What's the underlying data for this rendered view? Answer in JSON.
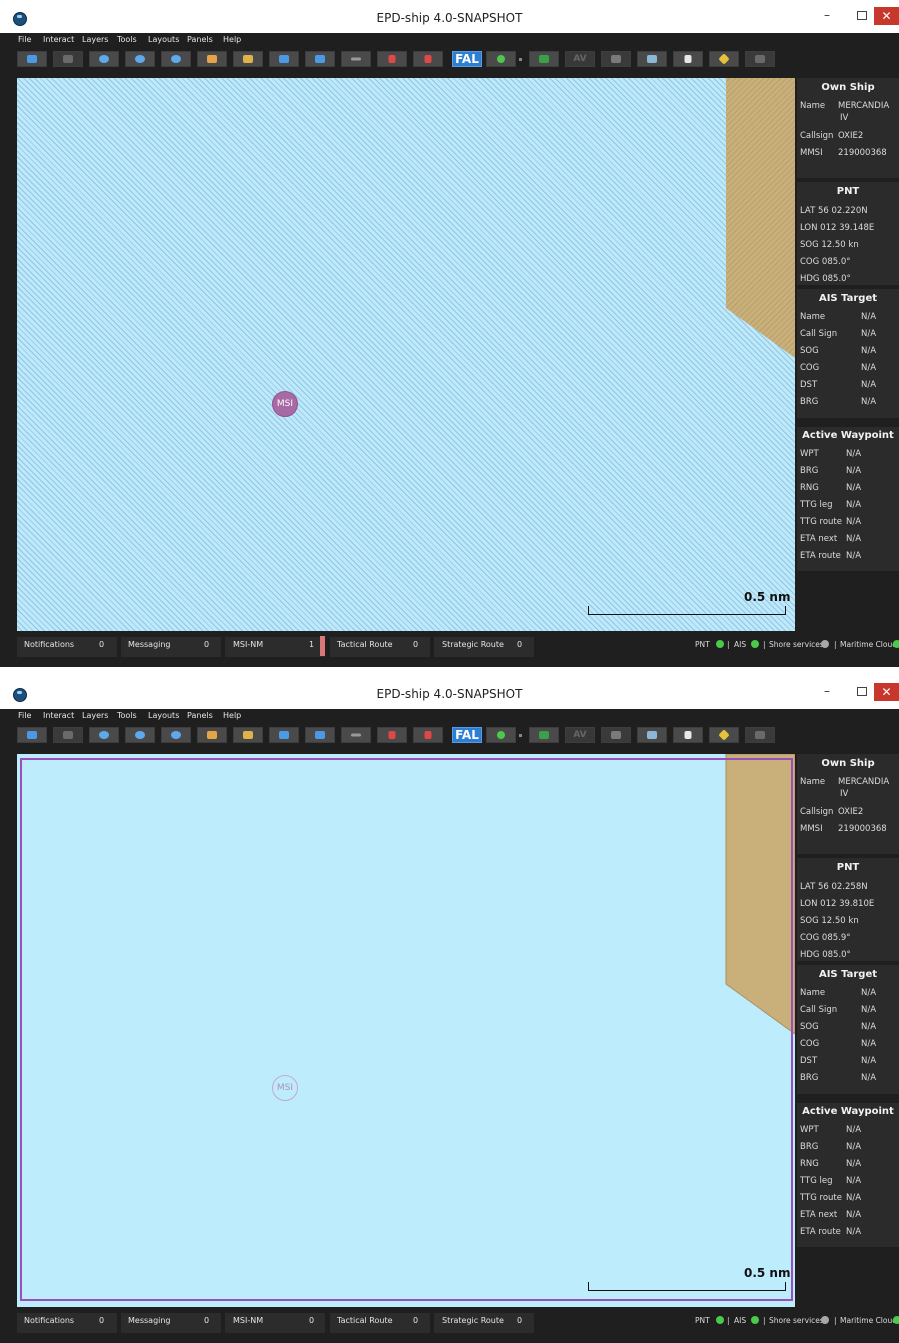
{
  "app": {
    "title": "EPD-ship 4.0-SNAPSHOT"
  },
  "window_controls": {
    "minimize": "–",
    "close": "✕"
  },
  "menu": [
    "File",
    "Interact",
    "Layers",
    "Tools",
    "Layouts",
    "Panels",
    "Help"
  ],
  "toolbar": {
    "fal_label": "FAL",
    "av_label": "AV"
  },
  "icons": [
    "back-arrow-icon",
    "forward-arrow-icon",
    "zoom-in-icon",
    "zoom-out-icon",
    "zoom-fit-icon",
    "pan-hand-icon",
    "ruler-icon",
    "center-target-icon",
    "route-arrow-icon",
    "wrench-icon",
    "new-waypoint-icon",
    "route-pin-icon",
    "fal-icon",
    "ais-status-icon",
    "nogo-icon",
    "av-icon",
    "layer-icon",
    "map-icon",
    "document-icon",
    "warning-sign-icon",
    "settings-icon"
  ],
  "colors": {
    "sea": "#bfe9fa",
    "land": "#c9b07a",
    "toolbar_bg": "#1f1f1f",
    "panel_bg": "#2b2b2b",
    "fal_blue": "#2d7fd4",
    "msi_purple": "#a86aa5",
    "boundary_purple": "#9a4fbf",
    "led_green": "#4ac94a"
  },
  "map": {
    "msi_label": "MSI",
    "scale_label": "0.5 nm"
  },
  "own_ship": {
    "title": "Own Ship",
    "name_label": "Name",
    "name_value_1": "MERCANDIA",
    "name_value_2": "IV",
    "callsign_label": "Callsign",
    "callsign_value": "OXIE2",
    "mmsi_label": "MMSI",
    "mmsi_value": "219000368"
  },
  "pnt_w1": {
    "title": "PNT",
    "lat": "LAT  56 02.220N",
    "lon": "LON  012 39.148E",
    "sog": "SOG  12.50 kn",
    "cog": "COG  085.0°",
    "hdg": "HDG  085.0°"
  },
  "pnt_w2": {
    "title": "PNT",
    "lat": "LAT  56 02.258N",
    "lon": "LON  012 39.810E",
    "sog": "SOG  12.50 kn",
    "cog": "COG  085.9°",
    "hdg": "HDG  085.0°"
  },
  "ais_target": {
    "title": "AIS Target",
    "rows": [
      {
        "label": "Name",
        "value": "N/A"
      },
      {
        "label": "Call Sign",
        "value": "N/A"
      },
      {
        "label": "SOG",
        "value": "N/A"
      },
      {
        "label": "COG",
        "value": "N/A"
      },
      {
        "label": "DST",
        "value": "N/A"
      },
      {
        "label": "BRG",
        "value": "N/A"
      }
    ]
  },
  "active_waypoint": {
    "title": "Active Waypoint",
    "rows": [
      {
        "label": "WPT",
        "value": "N/A"
      },
      {
        "label": "BRG",
        "value": "N/A"
      },
      {
        "label": "RNG",
        "value": "N/A"
      },
      {
        "label": "TTG leg",
        "value": "N/A"
      },
      {
        "label": "TTG route",
        "value": "N/A"
      },
      {
        "label": "ETA next",
        "value": "N/A"
      },
      {
        "label": "ETA route",
        "value": "N/A"
      }
    ]
  },
  "notices_w1": [
    {
      "label": "Notifications",
      "count": "0"
    },
    {
      "label": "Messaging",
      "count": "0"
    },
    {
      "label": "MSI-NM",
      "count": "1"
    },
    {
      "label": "Tactical Route",
      "count": "0"
    },
    {
      "label": "Strategic Route",
      "count": "0"
    }
  ],
  "notices_w2": [
    {
      "label": "Notifications",
      "count": "0"
    },
    {
      "label": "Messaging",
      "count": "0"
    },
    {
      "label": "MSI-NM",
      "count": "0"
    },
    {
      "label": "Tactical Route",
      "count": "0"
    },
    {
      "label": "Strategic Route",
      "count": "0"
    }
  ],
  "status": {
    "pnt": "PNT",
    "ais": "AIS",
    "shore": "Shore services",
    "cloud": "Maritime Cloud",
    "sep": "|"
  }
}
